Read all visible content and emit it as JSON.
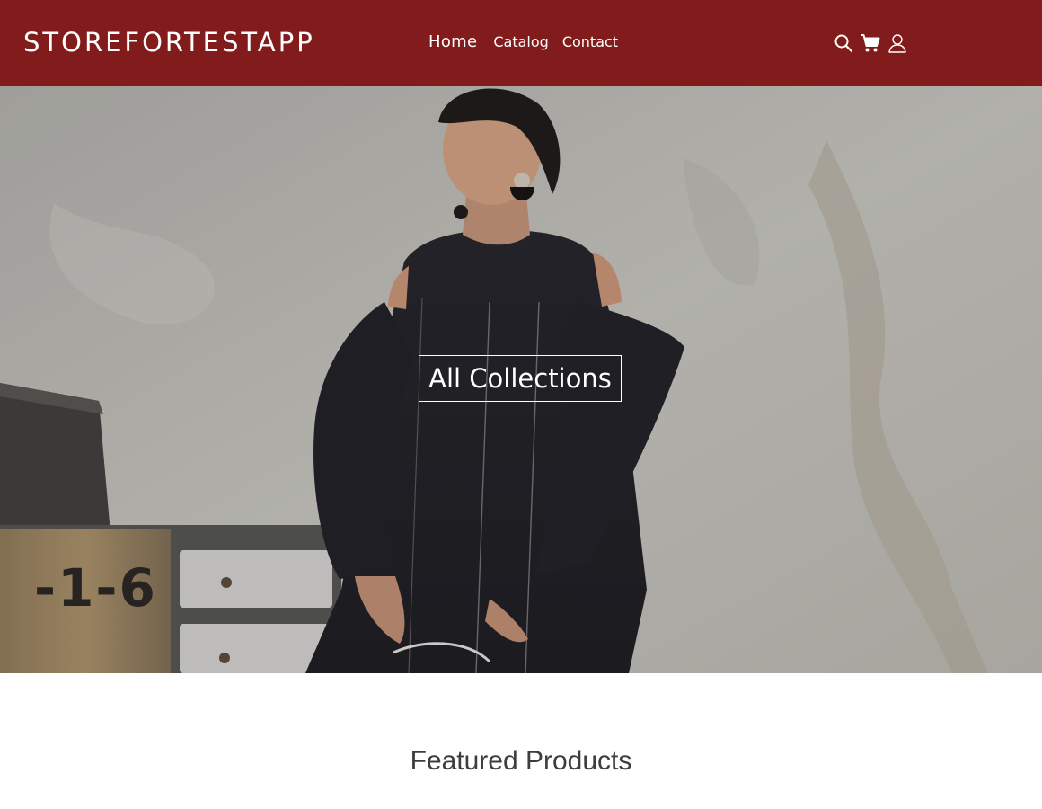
{
  "header": {
    "logo": "STOREFORTESTAPP",
    "nav": {
      "home": "Home",
      "catalog": "Catalog",
      "contact": "Contact"
    },
    "icons": [
      "search-icon",
      "cart-icon",
      "user-icon"
    ],
    "background_color": "#821c1c"
  },
  "hero": {
    "cta_label": "All Collections",
    "image_subject": "woman in black dress standing in front of a concrete wall and a wooden drawer chest"
  },
  "featured": {
    "title": "Featured Products"
  }
}
